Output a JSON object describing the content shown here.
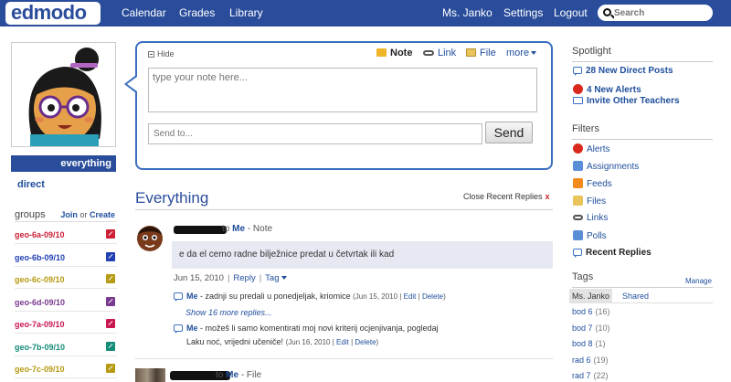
{
  "app": {
    "logo": "edmodo"
  },
  "nav": {
    "left": [
      "Calendar",
      "Grades",
      "Library"
    ],
    "right": [
      "Ms. Janko",
      "Settings",
      "Logout"
    ],
    "search_placeholder": "Search"
  },
  "left": {
    "filters": {
      "everything": "everything",
      "direct": "direct"
    },
    "groups": {
      "title": "groups",
      "join": "Join",
      "or": "or",
      "create": "Create",
      "items": [
        {
          "name": "geo-6a-09/10",
          "color": "#cc1f36"
        },
        {
          "name": "geo-6b-09/10",
          "color": "#1f3fb3"
        },
        {
          "name": "geo-6c-09/10",
          "color": "#b59a12"
        },
        {
          "name": "geo-6d-09/10",
          "color": "#7a3a8f"
        },
        {
          "name": "geo-7a-09/10",
          "color": "#c8174f"
        },
        {
          "name": "geo-7b-09/10",
          "color": "#148c77"
        },
        {
          "name": "geo-7c-09/10",
          "color": "#b59a12"
        }
      ]
    }
  },
  "composer": {
    "hide": "Hide",
    "tabs": [
      "Note",
      "Link",
      "File",
      "more"
    ],
    "note_placeholder": "type your note here...",
    "send_to_placeholder": "Send to...",
    "send_label": "Send"
  },
  "feed": {
    "title": "Everything",
    "close_replies": "Close Recent Replies",
    "close_x": "x",
    "post": {
      "to": "to",
      "recipient": "Me",
      "type": "- Note",
      "body": "e da el cemo radne bilježnice predat u četvrtak ili kad",
      "date": "Jun 15, 2010",
      "reply": "Reply",
      "tag": "Tag",
      "replies": [
        {
          "author": "Me",
          "text": "- zadnji su predali u ponedjeljak, kriomice",
          "date": "(Jun 15, 2010 |",
          "edit": "Edit",
          "sep": "|",
          "delete": "Delete",
          "close": ")"
        },
        {
          "author": "Me",
          "text": "- možeš li samo komentirati moj novi kriterij ocjenjivanja, pogledaj",
          "text2": "Laku noć, vrijedni učeniče!",
          "date": "(Jun 16, 2010 |",
          "edit": "Edit",
          "sep": "|",
          "delete": "Delete",
          "close": ")"
        }
      ],
      "show_more": "Show 16 more replies..."
    },
    "post2": {
      "to": "to",
      "recipient": "Me",
      "type": "- File"
    }
  },
  "right": {
    "spotlight": {
      "title": "Spotlight",
      "items": [
        "28 New Direct Posts",
        "4 New Alerts",
        "Invite Other Teachers"
      ]
    },
    "filters": {
      "title": "Filters",
      "items": [
        "Alerts",
        "Assignments",
        "Feeds",
        "Files",
        "Links",
        "Polls",
        "Recent Replies"
      ]
    },
    "tags": {
      "title": "Tags",
      "manage": "Manage",
      "tabs": [
        "Ms. Janko",
        "Shared"
      ],
      "items": [
        {
          "name": "bod 6",
          "count": "(16)"
        },
        {
          "name": "bod 7",
          "count": "(10)"
        },
        {
          "name": "bod 8",
          "count": "(1)"
        },
        {
          "name": "rad 6",
          "count": "(19)"
        },
        {
          "name": "rad 7",
          "count": "(22)"
        }
      ]
    }
  }
}
